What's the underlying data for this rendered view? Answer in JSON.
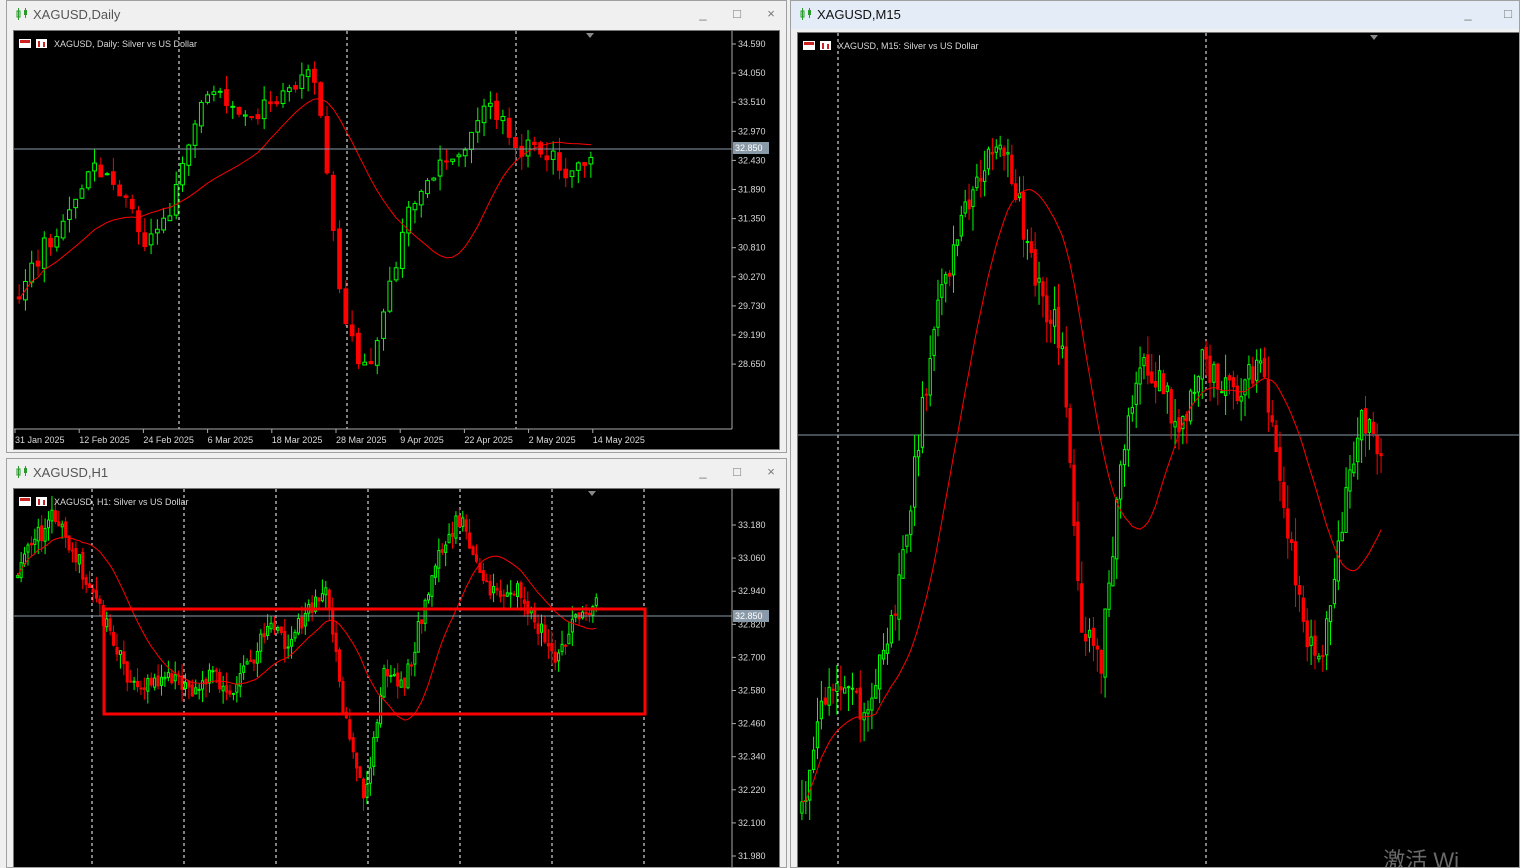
{
  "windows": {
    "daily": {
      "title": "XAGUSD,Daily",
      "chart_label": "XAGUSD, Daily:  Silver vs US Dollar",
      "buttons": [
        "_",
        "□",
        "×"
      ],
      "price_labels": [
        "34.590",
        "34.050",
        "33.510",
        "32.970",
        "32.430",
        "31.890",
        "31.350",
        "30.810",
        "30.270",
        "29.730",
        "29.190",
        "28.650"
      ],
      "current_price": "32.850",
      "date_labels": [
        "31 Jan 2025",
        "12 Feb 2025",
        "24 Feb 2025",
        "6 Mar 2025",
        "18 Mar 2025",
        "28 Mar 2025",
        "9 Apr 2025",
        "22 Apr 2025",
        "2 May 2025",
        "14 May 2025"
      ]
    },
    "h1": {
      "title": "XAGUSD,H1",
      "chart_label": "XAGUSD, H1:  Silver vs US Dollar",
      "buttons": [
        "_",
        "□",
        "×"
      ],
      "price_labels": [
        "33.180",
        "33.060",
        "32.940",
        "32.820",
        "32.700",
        "32.580",
        "32.460",
        "32.340",
        "32.220",
        "32.100",
        "31.980"
      ],
      "current_price": "32.850"
    },
    "m15": {
      "title": "XAGUSD,M15",
      "chart_label": "XAGUSD, M15:  Silver vs US Dollar",
      "buttons": [
        "_",
        "□"
      ]
    }
  },
  "colors": {
    "bull": "#00ff00",
    "bear": "#ff0000",
    "ma": "#ff0000",
    "grid": "#ffffff",
    "price_line": "#8a9aa8",
    "box": "#ff0000"
  },
  "watermark": "激活 Wi"
}
